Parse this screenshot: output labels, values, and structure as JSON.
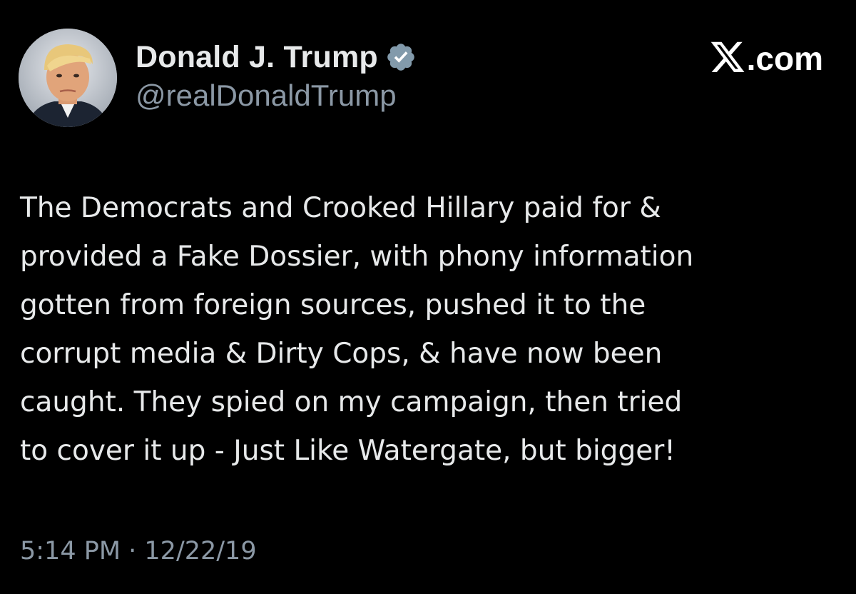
{
  "tweet": {
    "author": {
      "display_name": "Donald J. Trump",
      "handle": "@realDonaldTrump",
      "verified": true,
      "avatar_icon": "profile-photo"
    },
    "brand": {
      "logo_icon": "x-logo",
      "text": ".com"
    },
    "body_lines": [
      "The Democrats and Crooked Hillary paid for &",
      "provided a Fake Dossier, with phony information",
      "gotten from foreign sources, pushed it to the",
      "corrupt media & Dirty Cops, & have now been",
      "caught. They spied on my campaign, then tried",
      "to cover it up - Just Like Watergate, but bigger!"
    ],
    "timestamp": "5:14 PM · 12/22/19"
  },
  "colors": {
    "background": "#000000",
    "primary_text": "#e7e9ea",
    "secondary_text": "#8b98a5",
    "verified_badge": "#829aab"
  }
}
